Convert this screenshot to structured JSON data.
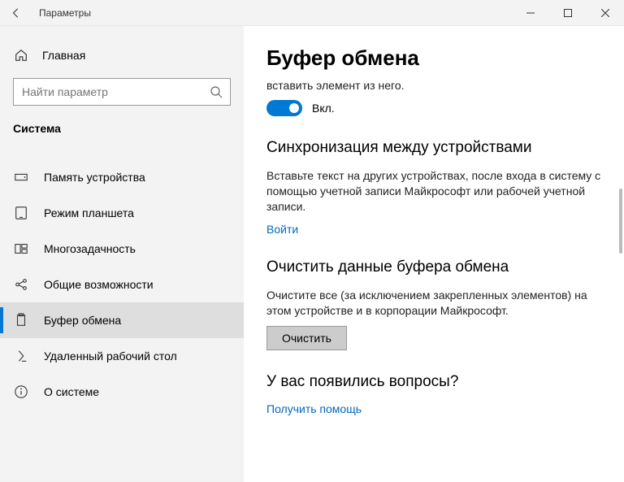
{
  "titlebar": {
    "title": "Параметры"
  },
  "sidebar": {
    "home": "Главная",
    "search_placeholder": "Найти параметр",
    "category": "Система",
    "items": [
      {
        "label": "Память устройства"
      },
      {
        "label": "Режим планшета"
      },
      {
        "label": "Многозадачность"
      },
      {
        "label": "Общие возможности"
      },
      {
        "label": "Буфер обмена"
      },
      {
        "label": "Удаленный рабочий стол"
      },
      {
        "label": "О системе"
      }
    ]
  },
  "content": {
    "title": "Буфер обмена",
    "history_desc": "вставить элемент из него.",
    "toggle_label": "Вкл.",
    "sync": {
      "heading": "Синхронизация между устройствами",
      "desc": "Вставьте текст на других устройствах, после входа в систему с помощью учетной записи Майкрософт или рабочей учетной записи.",
      "link": "Войти"
    },
    "clear": {
      "heading": "Очистить данные буфера обмена",
      "desc": "Очистите все (за исключением закрепленных элементов) на этом устройстве и в корпорации Майкрософт.",
      "button": "Очистить"
    },
    "help": {
      "heading": "У вас появились вопросы?",
      "link": "Получить помощь"
    }
  }
}
